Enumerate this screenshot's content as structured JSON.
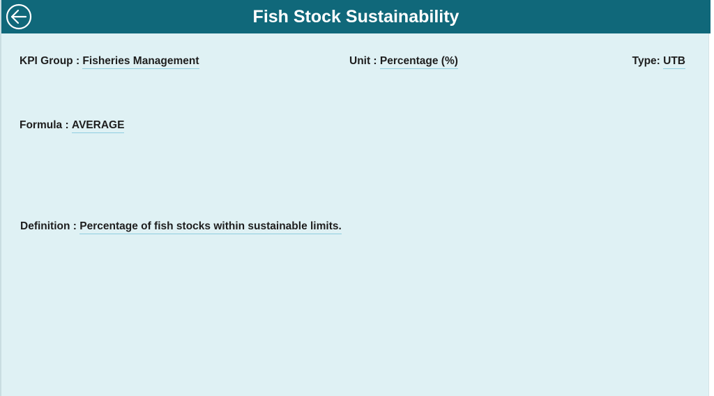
{
  "header": {
    "title": "Fish Stock Sustainability",
    "back_icon": "arrow-left-circle-icon",
    "color": "#10687a"
  },
  "fields": {
    "kpi_group": {
      "label": "KPI Group : ",
      "value": "Fisheries Management"
    },
    "unit": {
      "label": "Unit : ",
      "value": "Percentage (%)"
    },
    "type": {
      "label": "Type: ",
      "value": "UTB"
    },
    "formula": {
      "label": "Formula : ",
      "value": "AVERAGE"
    },
    "definition": {
      "label": "Definition : ",
      "value": "Percentage of fish stocks within sustainable limits."
    }
  },
  "colors": {
    "background": "#dff1f4",
    "underline": "#8fcde0"
  }
}
